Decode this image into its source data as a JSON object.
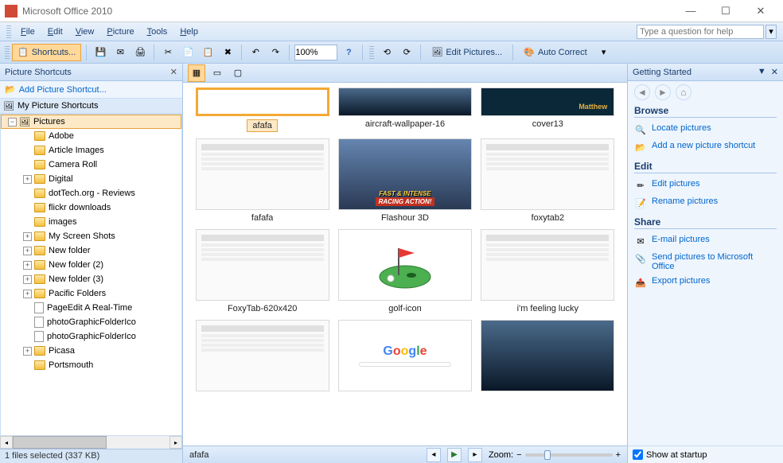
{
  "app": {
    "title": "Microsoft Office 2010"
  },
  "menu": {
    "file": "File",
    "edit": "Edit",
    "view": "View",
    "picture": "Picture",
    "tools": "Tools",
    "help": "Help"
  },
  "help_search": {
    "placeholder": "Type a question for help"
  },
  "toolbar": {
    "shortcuts": "Shortcuts...",
    "zoom": "100%",
    "edit_pictures": "Edit Pictures...",
    "auto_correct": "Auto Correct"
  },
  "left": {
    "title": "Picture Shortcuts",
    "add_shortcut": "Add Picture Shortcut...",
    "root": "My Picture Shortcuts",
    "selected": "Pictures",
    "items": [
      {
        "label": "Adobe",
        "expandable": false
      },
      {
        "label": "Article Images",
        "expandable": false
      },
      {
        "label": "Camera Roll",
        "expandable": false
      },
      {
        "label": "Digital",
        "expandable": true
      },
      {
        "label": "dotTech.org - Reviews",
        "expandable": false
      },
      {
        "label": "flickr downloads",
        "expandable": false
      },
      {
        "label": "images",
        "expandable": false
      },
      {
        "label": "My Screen Shots",
        "expandable": true
      },
      {
        "label": "New folder",
        "expandable": true
      },
      {
        "label": "New folder (2)",
        "expandable": true
      },
      {
        "label": "New folder (3)",
        "expandable": true
      },
      {
        "label": "Pacific Folders",
        "expandable": true
      },
      {
        "label": "PageEdit  A Real-Time",
        "expandable": false,
        "file": true
      },
      {
        "label": "photoGraphicFolderIco",
        "expandable": false,
        "file": true
      },
      {
        "label": "photoGraphicFolderIco",
        "expandable": false,
        "file": true
      },
      {
        "label": "Picasa",
        "expandable": true
      },
      {
        "label": "Portsmouth",
        "expandable": false
      }
    ],
    "status": "1 files selected (337 KB)"
  },
  "thumbs": [
    {
      "name": "afafa",
      "sel": true,
      "ph": "blank"
    },
    {
      "name": "aircraft-wallpaper-16",
      "ph": "dark"
    },
    {
      "name": "cover13",
      "ph": "dark2"
    },
    {
      "name": "fafafa",
      "ph": "doc"
    },
    {
      "name": "Flashour 3D",
      "ph": "race"
    },
    {
      "name": "foxytab2",
      "ph": "doc"
    },
    {
      "name": "FoxyTab-620x420",
      "ph": "doc"
    },
    {
      "name": "golf-icon",
      "ph": "golf"
    },
    {
      "name": "i'm feeling lucky",
      "ph": "doc"
    },
    {
      "name": "",
      "ph": "doc"
    },
    {
      "name": "",
      "ph": "google"
    },
    {
      "name": "",
      "ph": "dark"
    }
  ],
  "mid_status": {
    "current": "afafa",
    "zoom_label": "Zoom:"
  },
  "right": {
    "title": "Getting Started",
    "browse": {
      "header": "Browse",
      "locate": "Locate pictures",
      "add": "Add a new picture shortcut"
    },
    "edit": {
      "header": "Edit",
      "edit": "Edit pictures",
      "rename": "Rename pictures"
    },
    "share": {
      "header": "Share",
      "email": "E-mail pictures",
      "send": "Send pictures to Microsoft Office",
      "export": "Export pictures"
    },
    "show_startup": "Show at startup"
  }
}
